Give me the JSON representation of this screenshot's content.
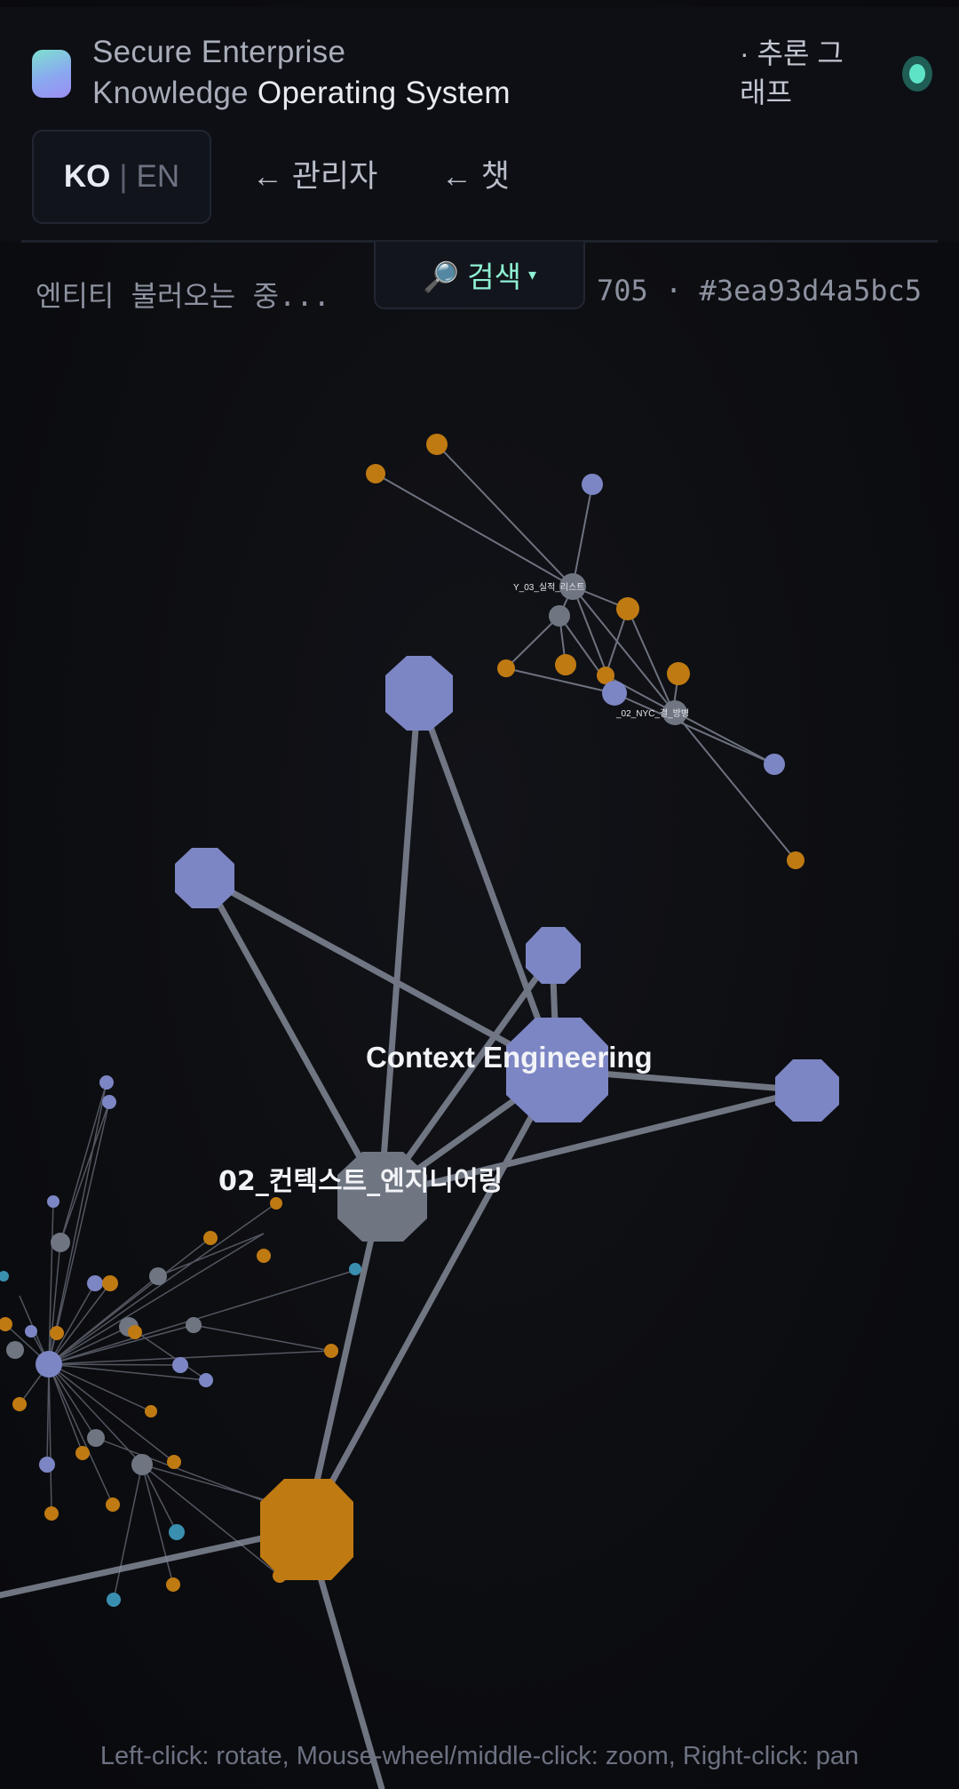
{
  "header": {
    "title_line1": "Secure Enterprise",
    "title_line2_a": "Knowledge",
    "title_line2_b": "Operating System",
    "subnav": "· 추론 그래프",
    "lang_ko": "KO",
    "lang_sep": "|",
    "lang_en": "EN",
    "admin_link": "← 관리자",
    "chat_link": "← 챗"
  },
  "toolbar": {
    "loading_text": "엔티티 불러오는 중...",
    "edge_text": "E 705 · #3ea93d4a5bc5",
    "search_label": "🔎 검색",
    "search_caret": "▾"
  },
  "graph": {
    "labels": {
      "context_engineering": "Context Engineering",
      "context_engineering_kr": "02_컨텍스트_엔지니어링",
      "small_label_1": "Y_03_실적_리스트",
      "small_label_2": "_02_NYC_결_방병"
    },
    "colors": {
      "concept": "#7d86c4",
      "document": "#6f7682",
      "entity": "#c07a12",
      "accent": "#3a8fb0",
      "edge": "#8d93a3"
    }
  },
  "footer": {
    "hint": "Left-click: rotate, Mouse-wheel/middle-click: zoom, Right-click: pan"
  }
}
